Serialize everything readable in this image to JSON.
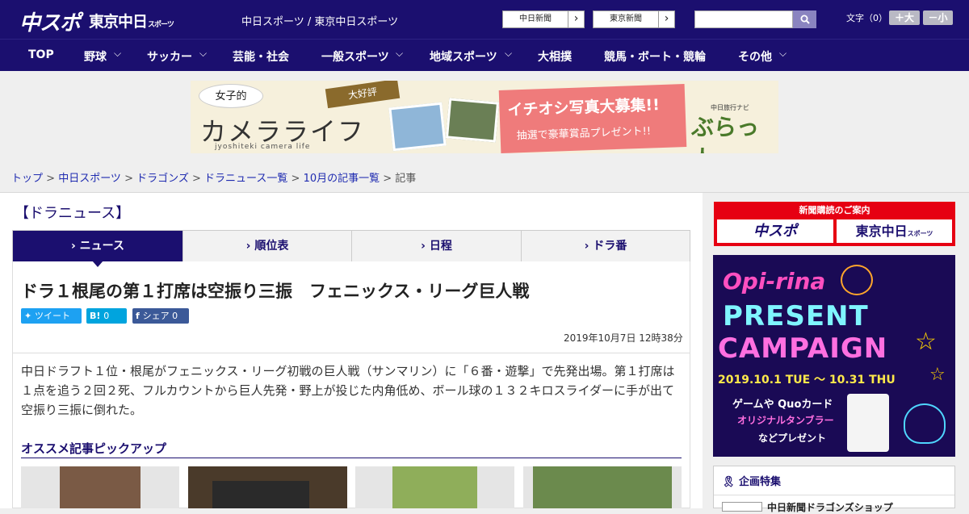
{
  "header": {
    "logo_main": "中スポ",
    "logo_tokyo": "東京中日",
    "logo_tokyo_suffix": "スポーツ",
    "site_name": "中日スポーツ / 東京中日スポーツ",
    "paper_buttons": [
      "中日新聞",
      "東京新聞"
    ],
    "font_label": "文字（0）",
    "font_larger": "＋大",
    "font_smaller": "－小"
  },
  "nav": {
    "items": [
      "TOP",
      "野球",
      "サッカー",
      "芸能・社会",
      "一般スポーツ",
      "地域スポーツ",
      "大相撲",
      "競馬・ボート・競輪",
      "その他"
    ]
  },
  "banner": {
    "joshi": "女子的",
    "daikohyo": "大好評",
    "camera_life": "カメラライフ",
    "romaji": "jyoshiteki camera life",
    "title": "イチオシ写真大募集!!",
    "subtitle": "抽選で豪華賞品プレゼント!!",
    "brand_small": "中日旅行ナビ",
    "brand": "ぶらっ人"
  },
  "breadcrumb": {
    "items": [
      "トップ",
      "中日スポーツ",
      "ドラゴンズ",
      "ドラニュース一覧",
      "10月の記事一覧"
    ],
    "current": "記事"
  },
  "section_title": "【ドラニュース】",
  "tabs": [
    "ニュース",
    "順位表",
    "日程",
    "ドラ番"
  ],
  "article": {
    "headline": "ドラ１根尾の第１打席は空振り三振　フェニックス・リーグ巨人戦",
    "share": {
      "tweet": "ツイート",
      "hatena_count": "0",
      "facebook": "シェア",
      "facebook_count": "0"
    },
    "date": "2019年10月7日 12時38分",
    "body": "中日ドラフト１位・根尾がフェニックス・リーグ初戦の巨人戦（サンマリン）に「６番・遊撃」で先発出場。第１打席は１点を追う２回２死、フルカウントから巨人先発・野上が投じた内角低め、ボール球の１３２キロスライダーに手が出て空振り三振に倒れた。"
  },
  "pickup": {
    "title": "オススメ記事ピックアップ"
  },
  "sidebar": {
    "subscribe": {
      "title": "新聞購読のご案内",
      "logo_chuspo": "中スポ",
      "logo_tokyo": "東京中日",
      "logo_tokyo_suffix": "スポーツ"
    },
    "campaign": {
      "brand": "Opi-rina",
      "line1": "PRESENT",
      "line2": "CAMPAIGN",
      "dates": "2019.10.1 TUE 〜 10.31 THU",
      "gift1": "ゲームや Quoカード",
      "gift2": "オリジナルタンブラー",
      "gift3": "などプレゼント"
    },
    "feature": {
      "title": "企画特集",
      "item1": "中日新聞ドラゴンズショップ"
    }
  },
  "colors": {
    "navy": "#1b0f6f",
    "red": "#e60012",
    "twitter": "#1da1f2",
    "hatena": "#00a4de",
    "facebook": "#3b5998"
  }
}
